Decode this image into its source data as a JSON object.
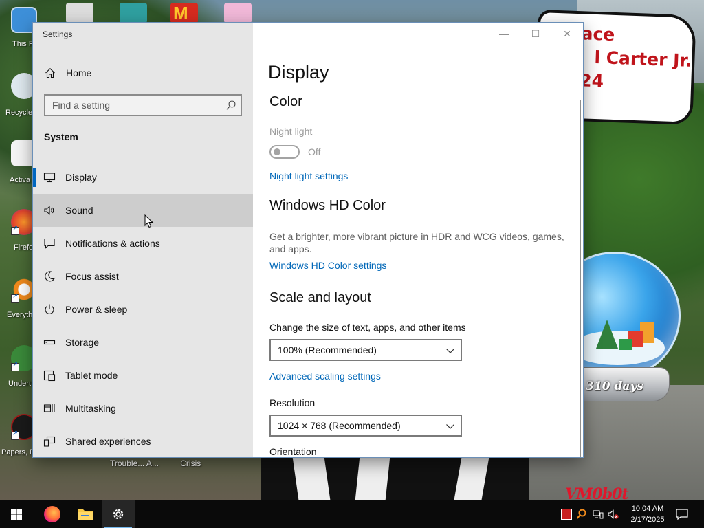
{
  "desktop": {
    "bubble_lines": [
      "ace",
      "l Carter Jr.",
      "24"
    ],
    "snow_globe_days": "310 days",
    "watermark": "VM0b0t",
    "icons": [
      {
        "label": "This P"
      },
      {
        "label": "Recycle"
      },
      {
        "label": "Activa"
      },
      {
        "label": "Firefo"
      },
      {
        "label": "Everyth"
      },
      {
        "label": "Undert"
      },
      {
        "label": "Papers, P"
      }
    ],
    "below_window_labels": [
      "Trouble... A...",
      "Crisis"
    ]
  },
  "window": {
    "title": "Settings",
    "controls": {
      "minimize": "—",
      "maximize": "☐",
      "close": "✕"
    }
  },
  "nav": {
    "home_label": "Home",
    "search_placeholder": "Find a setting",
    "section_heading": "System",
    "items": [
      {
        "label": "Display",
        "icon": "monitor-icon"
      },
      {
        "label": "Sound",
        "icon": "speaker-icon"
      },
      {
        "label": "Notifications & actions",
        "icon": "notification-icon"
      },
      {
        "label": "Focus assist",
        "icon": "moon-icon"
      },
      {
        "label": "Power & sleep",
        "icon": "power-icon"
      },
      {
        "label": "Storage",
        "icon": "storage-icon"
      },
      {
        "label": "Tablet mode",
        "icon": "tablet-icon"
      },
      {
        "label": "Multitasking",
        "icon": "multitasking-icon"
      },
      {
        "label": "Shared experiences",
        "icon": "shared-experiences-icon"
      }
    ]
  },
  "content": {
    "page_title": "Display",
    "color_heading": "Color",
    "night_light_label": "Night light",
    "night_light_state": "Off",
    "night_light_settings_link": "Night light settings",
    "hd_color_heading": "Windows HD Color",
    "hd_color_description": "Get a brighter, more vibrant picture in HDR and WCG videos, games, and apps.",
    "hd_color_settings_link": "Windows HD Color settings",
    "scale_heading": "Scale and layout",
    "scale_label": "Change the size of text, apps, and other items",
    "scale_value": "100% (Recommended)",
    "advanced_scaling_link": "Advanced scaling settings",
    "resolution_label": "Resolution",
    "resolution_value": "1024 × 768 (Recommended)",
    "orientation_label": "Orientation"
  },
  "taskbar": {
    "clock_time": "10:04 AM",
    "clock_date": "2/17/2025",
    "accent_color": "#76b9ed"
  },
  "colors": {
    "link": "#0067b8",
    "selected_indicator": "#0067c0",
    "nav_background": "#e6e6e6"
  }
}
